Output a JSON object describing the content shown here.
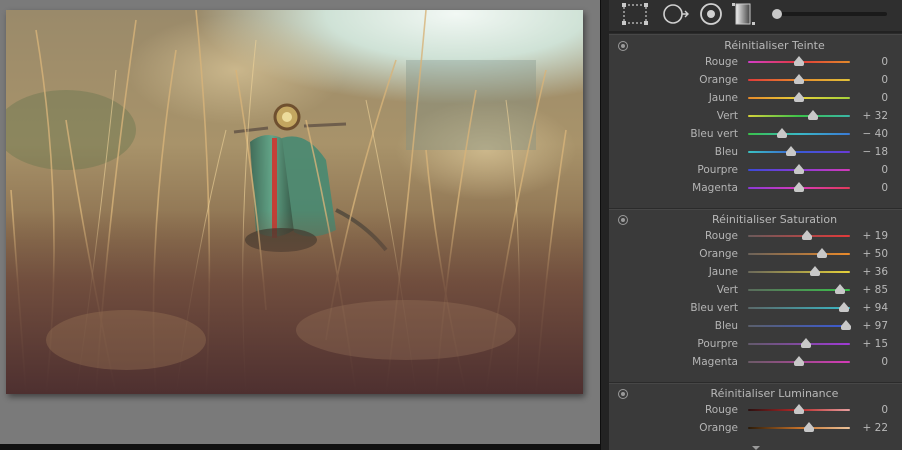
{
  "colors": {
    "panel_bg": "#3a3a3a",
    "toolbar_bg": "#2f2f2f",
    "canvas_bg": "#7a7a7a",
    "label_text": "#b5b5b5"
  },
  "toolbar": {
    "icons": [
      "selection-marquee-icon",
      "circle-arrow-icon",
      "target-circle-icon",
      "gradient-square-icon",
      "slider-track-icon"
    ]
  },
  "sections": [
    {
      "title": "Réinitialiser Teinte",
      "rows": [
        {
          "label": "Rouge",
          "value": "0",
          "position": 0.5,
          "gradient": "linear-gradient(to right,#d23cc8,#e23a3a,#e28a2a)"
        },
        {
          "label": "Orange",
          "value": "0",
          "position": 0.5,
          "gradient": "linear-gradient(to right,#e03a3a,#e78a2a,#e0c23a)"
        },
        {
          "label": "Jaune",
          "value": "0",
          "position": 0.5,
          "gradient": "linear-gradient(to right,#e68a2a,#e6d03a,#a6d23a)"
        },
        {
          "label": "Vert",
          "value": "+ 32",
          "position": 0.64,
          "gradient": "linear-gradient(to right,#d6d23a,#3ac24a,#3ab6a8)"
        },
        {
          "label": "Bleu vert",
          "value": "− 40",
          "position": 0.33,
          "gradient": "linear-gradient(to right,#3ac24a,#3ab8c6,#3a7ad6)"
        },
        {
          "label": "Bleu",
          "value": "− 18",
          "position": 0.42,
          "gradient": "linear-gradient(to right,#3ac2c2,#3a5ad6,#6a3ad6)"
        },
        {
          "label": "Pourpre",
          "value": "0",
          "position": 0.5,
          "gradient": "linear-gradient(to right,#3a4ad6,#8a3ad6,#d23ab8)"
        },
        {
          "label": "Magenta",
          "value": "0",
          "position": 0.5,
          "gradient": "linear-gradient(to right,#8a3ad6,#d63ab8,#e23a5a)"
        }
      ]
    },
    {
      "title": "Réinitialiser Saturation",
      "rows": [
        {
          "label": "Rouge",
          "value": "+ 19",
          "position": 0.58,
          "gradient": "linear-gradient(to right,#6a5a5a,#e23a3a)"
        },
        {
          "label": "Orange",
          "value": "+ 50",
          "position": 0.73,
          "gradient": "linear-gradient(to right,#6a625a,#ea8a2a)"
        },
        {
          "label": "Jaune",
          "value": "+ 36",
          "position": 0.66,
          "gradient": "linear-gradient(to right,#6a685a,#e6d23a)"
        },
        {
          "label": "Vert",
          "value": "+ 85",
          "position": 0.9,
          "gradient": "linear-gradient(to right,#5a6a5c,#3ac24a)"
        },
        {
          "label": "Bleu vert",
          "value": "+ 94",
          "position": 0.94,
          "gradient": "linear-gradient(to right,#5a6868,#3ab8c6)"
        },
        {
          "label": "Bleu",
          "value": "+ 97",
          "position": 0.96,
          "gradient": "linear-gradient(to right,#5a5e6a,#3a5ad6)"
        },
        {
          "label": "Pourpre",
          "value": "+ 15",
          "position": 0.57,
          "gradient": "linear-gradient(to right,#625a6a,#a03ad6)"
        },
        {
          "label": "Magenta",
          "value": "0",
          "position": 0.5,
          "gradient": "linear-gradient(to right,#6a5a66,#d63ab8)"
        }
      ]
    },
    {
      "title": "Réinitialiser Luminance",
      "rows": [
        {
          "label": "Rouge",
          "value": "0",
          "position": 0.5,
          "gradient": "linear-gradient(to right,#2a1010,#b82a2a,#e8a0a0)"
        },
        {
          "label": "Orange",
          "value": "+ 22",
          "position": 0.6,
          "gradient": "linear-gradient(to right,#2a1a08,#c2702a,#ecc29a)"
        }
      ]
    }
  ]
}
